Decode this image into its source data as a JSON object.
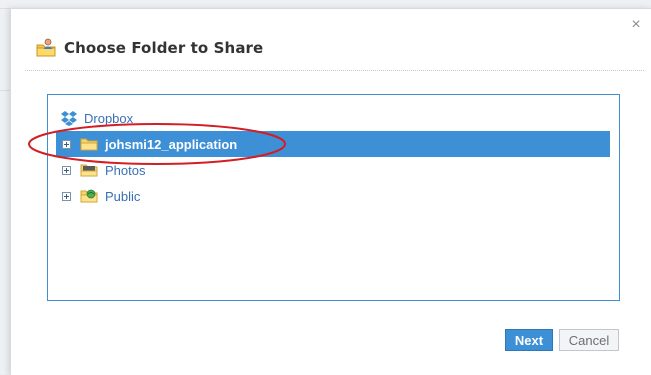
{
  "dialog": {
    "title": "Choose Folder to Share",
    "close_symbol": "×"
  },
  "tree": {
    "root": {
      "label": "Dropbox",
      "icon": "dropbox-icon"
    },
    "items": [
      {
        "label": "johsmi12_application",
        "icon": "folder-icon",
        "selected": true
      },
      {
        "label": "Photos",
        "icon": "photos-folder-icon",
        "selected": false
      },
      {
        "label": "Public",
        "icon": "public-folder-icon",
        "selected": false
      }
    ]
  },
  "buttons": {
    "next_label": "Next",
    "cancel_label": "Cancel"
  },
  "colors": {
    "accent": "#3d8fd6",
    "annotation": "#d21f26",
    "link_text": "#3a6fb5"
  }
}
